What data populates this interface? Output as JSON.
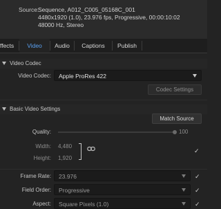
{
  "summary": {
    "source_label": "Source:",
    "lines": [
      "Sequence, A012_C005_05168C_001",
      "4480x1920 (1.0), 23.976 fps, Progressive, 00:00:10:02",
      "48000 Hz, Stereo"
    ]
  },
  "tabs": [
    {
      "label": "ffects",
      "active": false
    },
    {
      "label": "Video",
      "active": true
    },
    {
      "label": "Audio",
      "active": false
    },
    {
      "label": "Captions",
      "active": false
    },
    {
      "label": "Publish",
      "active": false
    }
  ],
  "video_codec": {
    "section_title": "Video Codec",
    "codec_label": "Video Codec:",
    "codec_value": "Apple ProRes 422",
    "codec_settings_button": "Codec Settings"
  },
  "basic_video_settings": {
    "section_title": "Basic Video Settings",
    "match_source_button": "Match Source",
    "quality_label": "Quality:",
    "quality_value": "100",
    "width_label": "Width:",
    "width_value": "4,480",
    "height_label": "Height:",
    "height_value": "1,920",
    "frame_rate_label": "Frame Rate:",
    "frame_rate_value": "23.976",
    "field_order_label": "Field Order:",
    "field_order_value": "Progressive",
    "aspect_label": "Aspect:",
    "aspect_value": "Square Pixels (1.0)"
  },
  "icons": {
    "checkmark": "✓",
    "link": "chain-link-icon"
  }
}
